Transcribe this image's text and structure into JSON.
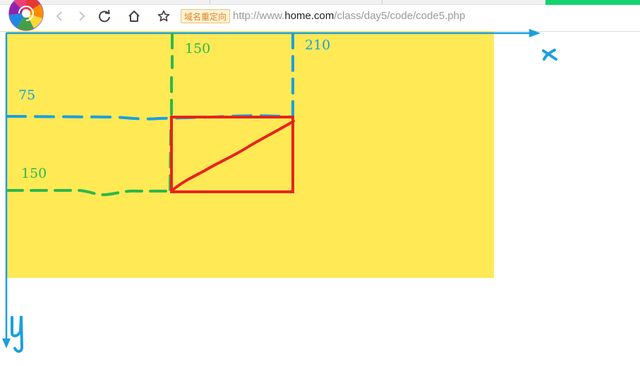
{
  "browser": {
    "redirect_badge": "域名重定向",
    "url_prefix": "http://www.",
    "url_host": "home.com",
    "url_path": "/class/day5/code/code5.php",
    "icons": [
      "logo-icon",
      "back-icon",
      "forward-icon",
      "reload-icon",
      "home-icon",
      "bookmark-star-icon"
    ]
  },
  "diagram": {
    "colors": {
      "canvas_fill": "#ffe955",
      "axis": "#1a9fe0",
      "green_guide": "#2db84a",
      "blue_guide": "#1a9fe0",
      "rectangle": "#e8231f"
    },
    "labels": {
      "top_green": "150",
      "top_blue": "210",
      "left_blue": "75",
      "left_green": "150",
      "x_axis": "x",
      "y_axis": "y"
    }
  }
}
